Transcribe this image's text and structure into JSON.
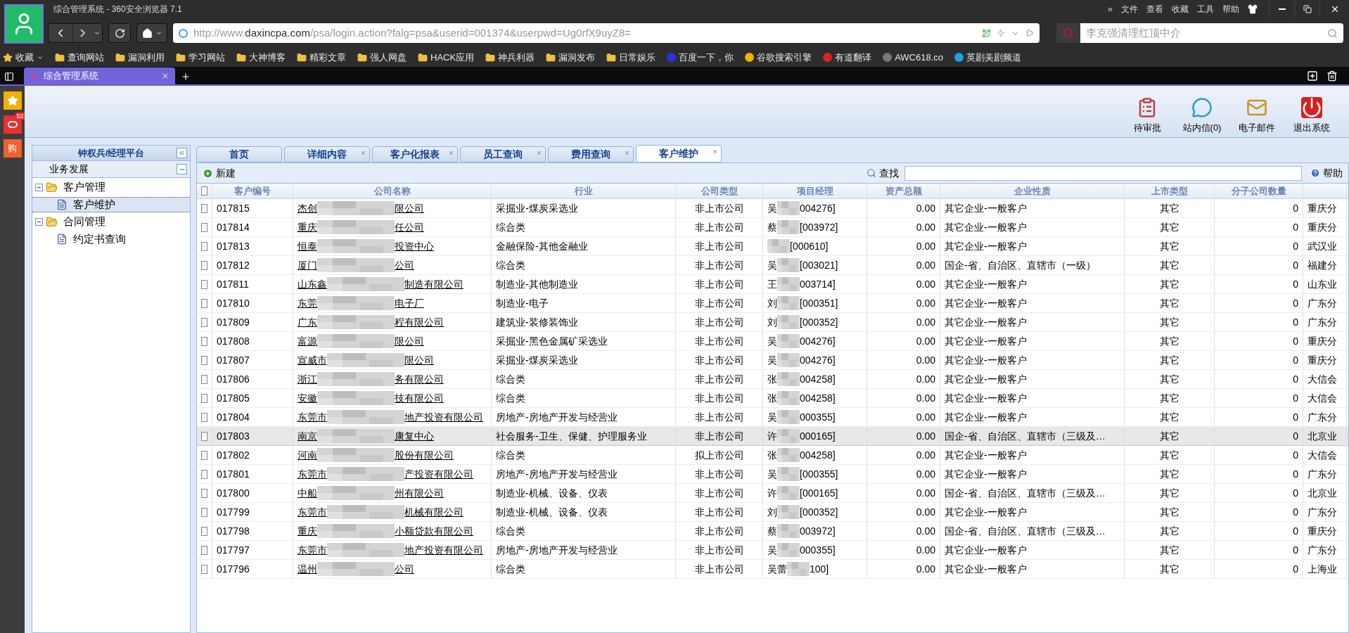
{
  "browser": {
    "title": "综合管理系统 - 360安全浏览器 7.1",
    "menu_more": "»",
    "menu": [
      "文件",
      "查看",
      "收藏",
      "工具",
      "帮助"
    ],
    "url": {
      "scheme": "http://www.",
      "host": "daxincpa.com",
      "rest": "/psa/login.action?falg=psa&userid=001374&userpwd=Ug0rfX9uyZ8="
    },
    "search": {
      "placeholder": "李克强清理红顶中介"
    },
    "favorites": "收藏",
    "bookmarks": [
      {
        "label": "查询网站",
        "kind": "folder"
      },
      {
        "label": "漏洞利用",
        "kind": "folder"
      },
      {
        "label": "学习网站",
        "kind": "folder"
      },
      {
        "label": "大神博客",
        "kind": "folder"
      },
      {
        "label": "精彩文章",
        "kind": "folder"
      },
      {
        "label": "强人网盘",
        "kind": "folder"
      },
      {
        "label": "HACK应用",
        "kind": "folder"
      },
      {
        "label": "神兵利器",
        "kind": "folder"
      },
      {
        "label": "漏洞发布",
        "kind": "folder"
      },
      {
        "label": "日常娱乐",
        "kind": "folder"
      },
      {
        "label": "百度一下，你",
        "kind": "site",
        "color": "#2932e1"
      },
      {
        "label": "谷歌搜索引擎",
        "kind": "site",
        "color": "#e8b400"
      },
      {
        "label": "有道翻译",
        "kind": "site",
        "color": "#e02020"
      },
      {
        "label": "AWC618.co",
        "kind": "site",
        "color": "#777777"
      },
      {
        "label": "英剧美剧频道",
        "kind": "site",
        "color": "#1aa3e8"
      }
    ],
    "tab": {
      "label": "综合管理系统"
    },
    "side_badge": "52",
    "side_shop": "购"
  },
  "app": {
    "actions": [
      "待审批",
      "站内信(0)",
      "电子邮件",
      "退出系统"
    ],
    "sidebar": {
      "title": "钟权兵/经理平台",
      "section": "业务发展",
      "tree": [
        {
          "label": "客户管理",
          "expanded": true,
          "children": [
            {
              "label": "客户维护",
              "selected": true
            }
          ]
        },
        {
          "label": "合同管理",
          "expanded": true,
          "children": [
            {
              "label": "约定书查询",
              "selected": false
            }
          ]
        }
      ]
    },
    "tabs": [
      {
        "label": "首页",
        "closable": false,
        "selected": false
      },
      {
        "label": "详细内容",
        "closable": true,
        "selected": false
      },
      {
        "label": "客户化报表",
        "closable": true,
        "selected": false
      },
      {
        "label": "员工查询",
        "closable": true,
        "selected": false
      },
      {
        "label": "费用查询",
        "closable": true,
        "selected": false
      },
      {
        "label": "客户维护",
        "closable": true,
        "selected": true
      }
    ],
    "toolbar": {
      "new": "新建",
      "search_label": "查找",
      "help": "帮助"
    },
    "table": {
      "select_all_checked": false,
      "columns": [
        "客户编号",
        "公司名称",
        "行业",
        "公司类型",
        "项目经理",
        "资产总额",
        "企业性质",
        "上市类型",
        "分子公司数量"
      ],
      "rows": [
        {
          "id": "017815",
          "name_start": "杰创",
          "name_end": "限公司",
          "industry": "采掘业-煤炭采选业",
          "type": "非上市公司",
          "manager_start": "吴",
          "manager_end": "004276]",
          "assets": "0.00",
          "nature": "其它企业-一般客户",
          "listing": "其它",
          "subs": "0",
          "column_10": "重庆分",
          "selected": false
        },
        {
          "id": "017814",
          "name_start": "重庆",
          "name_end": "任公司",
          "industry": "综合类",
          "type": "非上市公司",
          "manager_start": "蔡",
          "manager_end": "[003972]",
          "assets": "0.00",
          "nature": "其它企业-一般客户",
          "listing": "其它",
          "subs": "0",
          "column_10": "重庆分",
          "selected": false
        },
        {
          "id": "017813",
          "name_start": "恒泰",
          "name_end": "投资中心",
          "industry": "金融保险-其他金融业",
          "type": "非上市公司",
          "manager_end": "[000610]",
          "assets": "0.00",
          "nature": "其它企业-一般客户",
          "listing": "其它",
          "subs": "0",
          "column_10": "武汉业",
          "selected": false
        },
        {
          "id": "017812",
          "name_start": "厦门",
          "name_end": "公司",
          "industry": "综合类",
          "type": "非上市公司",
          "manager_start": "吴",
          "manager_end": "[003021]",
          "assets": "0.00",
          "nature": "国企-省、自治区、直辖市（一级）",
          "listing": "其它",
          "subs": "0",
          "column_10": "福建分",
          "selected": false
        },
        {
          "id": "017811",
          "name_start": "山东鑫",
          "name_end": "制造有限公司",
          "industry": "制造业-其他制造业",
          "type": "非上市公司",
          "manager_start": "王",
          "manager_end": "003714]",
          "assets": "0.00",
          "nature": "其它企业-一般客户",
          "listing": "其它",
          "subs": "0",
          "column_10": "山东业",
          "selected": false
        },
        {
          "id": "017810",
          "name_start": "东莞",
          "name_end": "电子厂",
          "industry": "制造业-电子",
          "type": "非上市公司",
          "manager_start": "刘",
          "manager_end": "[000351]",
          "assets": "0.00",
          "nature": "其它企业-一般客户",
          "listing": "其它",
          "subs": "0",
          "column_10": "广东分",
          "selected": false
        },
        {
          "id": "017809",
          "name_start": "广东",
          "name_end": "程有限公司",
          "industry": "建筑业-装修装饰业",
          "type": "非上市公司",
          "manager_start": "刘",
          "manager_end": "[000352]",
          "assets": "0.00",
          "nature": "其它企业-一般客户",
          "listing": "其它",
          "subs": "0",
          "column_10": "广东分",
          "selected": false
        },
        {
          "id": "017808",
          "name_start": "富源",
          "name_end": "限公司",
          "industry": "采掘业-黑色金属矿采选业",
          "type": "非上市公司",
          "manager_start": "吴",
          "manager_end": "004276]",
          "assets": "0.00",
          "nature": "其它企业-一般客户",
          "listing": "其它",
          "subs": "0",
          "column_10": "重庆分",
          "selected": false
        },
        {
          "id": "017807",
          "name_start": "宣威市",
          "name_end": "限公司",
          "industry": "采掘业-煤炭采选业",
          "type": "非上市公司",
          "manager_start": "吴",
          "manager_end": "004276]",
          "assets": "0.00",
          "nature": "其它企业-一般客户",
          "listing": "其它",
          "subs": "0",
          "column_10": "重庆分",
          "selected": false
        },
        {
          "id": "017806",
          "name_start": "浙江",
          "name_end": "务有限公司",
          "industry": "综合类",
          "type": "非上市公司",
          "manager_start": "张",
          "manager_end": "004258]",
          "assets": "0.00",
          "nature": "其它企业-一般客户",
          "listing": "其它",
          "subs": "0",
          "column_10": "大信会",
          "selected": false
        },
        {
          "id": "017805",
          "name_start": "安徽",
          "name_end": "技有限公司",
          "industry": "综合类",
          "type": "非上市公司",
          "manager_start": "张",
          "manager_end": "004258]",
          "assets": "0.00",
          "nature": "其它企业-一般客户",
          "listing": "其它",
          "subs": "0",
          "column_10": "大信会",
          "selected": false
        },
        {
          "id": "017804",
          "name_start": "东莞市",
          "name_end": "地产投资有限公司",
          "industry": "房地产-房地产开发与经营业",
          "type": "非上市公司",
          "manager_start": "吴",
          "manager_end": "000355]",
          "assets": "0.00",
          "nature": "其它企业-一般客户",
          "listing": "其它",
          "subs": "0",
          "column_10": "广东分",
          "selected": false
        },
        {
          "id": "017803",
          "name_start": "南京",
          "name_end": "康复中心",
          "industry": "社会服务-卫生、保健、护理服务业",
          "type": "非上市公司",
          "manager_start": "许",
          "manager_end": "000165]",
          "assets": "0.00",
          "nature": "国企-省、自治区、直辖市（三级及…",
          "listing": "其它",
          "subs": "0",
          "column_10": "北京业",
          "selected": true
        },
        {
          "id": "017802",
          "name_start": "河南",
          "name_end": "股份有限公司",
          "industry": "综合类",
          "type": "拟上市公司",
          "manager_start": "张",
          "manager_end": "004258]",
          "assets": "0.00",
          "nature": "其它企业-一般客户",
          "listing": "其它",
          "subs": "0",
          "column_10": "大信会",
          "selected": false
        },
        {
          "id": "017801",
          "name_start": "东莞市",
          "name_end": "产投资有限公司",
          "industry": "房地产-房地产开发与经营业",
          "type": "非上市公司",
          "manager_start": "吴",
          "manager_end": "[000355]",
          "assets": "0.00",
          "nature": "其它企业-一般客户",
          "listing": "其它",
          "subs": "0",
          "column_10": "广东分",
          "selected": false
        },
        {
          "id": "017800",
          "name_start": "中船",
          "name_end": "州有限公司",
          "industry": "制造业-机械、设备、仪表",
          "type": "非上市公司",
          "manager_start": "许",
          "manager_end": "[000165]",
          "assets": "0.00",
          "nature": "国企-省、自治区、直辖市（三级及…",
          "listing": "其它",
          "subs": "0",
          "column_10": "北京业",
          "selected": false
        },
        {
          "id": "017799",
          "name_start": "东莞市",
          "name_end": "机械有限公司",
          "industry": "制造业-机械、设备、仪表",
          "type": "非上市公司",
          "manager_start": "刘",
          "manager_end": "[000352]",
          "assets": "0.00",
          "nature": "其它企业-一般客户",
          "listing": "其它",
          "subs": "0",
          "column_10": "广东分",
          "selected": false
        },
        {
          "id": "017798",
          "name_start": "重庆",
          "name_end": "小额贷款有限公司",
          "industry": "综合类",
          "type": "非上市公司",
          "manager_start": "蔡",
          "manager_end": "003972]",
          "assets": "0.00",
          "nature": "国企-省、自治区、直辖市（三级及…",
          "listing": "其它",
          "subs": "0",
          "column_10": "重庆分",
          "selected": false
        },
        {
          "id": "017797",
          "name_start": "东莞市",
          "name_end": "地产投资有限公司",
          "industry": "房地产-房地产开发与经营业",
          "type": "非上市公司",
          "manager_start": "吴",
          "manager_end": "000355]",
          "assets": "0.00",
          "nature": "其它企业-一般客户",
          "listing": "其它",
          "subs": "0",
          "column_10": "广东分",
          "selected": false
        },
        {
          "id": "017796",
          "name_start": "温州",
          "name_end": "公司",
          "industry": "综合类",
          "type": "非上市公司",
          "manager_start": "吴蕾",
          "manager_end": "100]",
          "assets": "0.00",
          "nature": "其它企业-一般客户",
          "listing": "其它",
          "subs": "0",
          "column_10": "上海业",
          "selected": false
        }
      ]
    }
  }
}
